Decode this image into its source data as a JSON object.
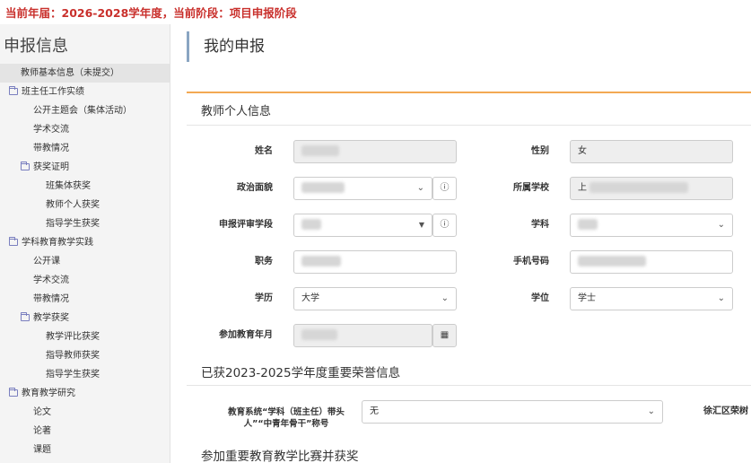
{
  "top_banner": "当前年届：2026-2028学年度，当前阶段：项目申报阶段",
  "sidebar": {
    "title": "申报信息",
    "items": [
      {
        "label": "教师基本信息（未提交）",
        "level": "l1-leaf",
        "folder": false,
        "active": true
      },
      {
        "label": "班主任工作实绩",
        "level": "l1",
        "folder": true
      },
      {
        "label": "公开主题会（集体活动）",
        "level": "l2-leaf",
        "folder": false
      },
      {
        "label": "学术交流",
        "level": "l2-leaf",
        "folder": false
      },
      {
        "label": "带教情况",
        "level": "l2-leaf",
        "folder": false
      },
      {
        "label": "获奖证明",
        "level": "l2",
        "folder": true
      },
      {
        "label": "班集体获奖",
        "level": "l3-leaf",
        "folder": false
      },
      {
        "label": "教师个人获奖",
        "level": "l3-leaf",
        "folder": false
      },
      {
        "label": "指导学生获奖",
        "level": "l3-leaf",
        "folder": false
      },
      {
        "label": "学科教育教学实践",
        "level": "l1",
        "folder": true
      },
      {
        "label": "公开课",
        "level": "l2-leaf",
        "folder": false
      },
      {
        "label": "学术交流",
        "level": "l2-leaf",
        "folder": false
      },
      {
        "label": "带教情况",
        "level": "l2-leaf",
        "folder": false
      },
      {
        "label": "教学获奖",
        "level": "l2",
        "folder": true
      },
      {
        "label": "教学评比获奖",
        "level": "l3-leaf",
        "folder": false
      },
      {
        "label": "指导教师获奖",
        "level": "l3-leaf",
        "folder": false
      },
      {
        "label": "指导学生获奖",
        "level": "l3-leaf",
        "folder": false
      },
      {
        "label": "教育教学研究",
        "level": "l1",
        "folder": true
      },
      {
        "label": "论文",
        "level": "l2-leaf",
        "folder": false
      },
      {
        "label": "论著",
        "level": "l2-leaf",
        "folder": false
      },
      {
        "label": "课题",
        "level": "l2-leaf",
        "folder": false
      }
    ]
  },
  "page": {
    "title": "我的申报",
    "card_title": "教师个人信息",
    "section2_title": "已获2023-2025学年度重要荣誉信息",
    "section3_title": "参加重要教育教学比赛并获奖"
  },
  "form": {
    "name_label": "姓名",
    "gender_label": "性别",
    "gender_value": "女",
    "politics_label": "政治面貌",
    "school_label": "所属学校",
    "school_value_prefix": "上",
    "stage_label": "申报评审学段",
    "subject_label": "学科",
    "position_label": "职务",
    "phone_label": "手机号码",
    "education_label": "学历",
    "education_value": "大学",
    "degree_label": "学位",
    "degree_value": "学士",
    "work_year_label": "参加教育年月",
    "honor_label_line1": "教育系统“学科（班主任）带头",
    "honor_label_line2": "人”“中青年骨干”称号",
    "honor_value": "无",
    "honor_right_label": "徐汇区荣树"
  },
  "icons": {
    "help": "question-circle-icon",
    "calendar": "calendar-icon",
    "chevron": "chevron-down-icon",
    "caret": "caret-down-icon",
    "folder": "folder-icon"
  },
  "colors": {
    "banner_red": "#c9302c",
    "accent_orange": "#f3a953",
    "header_bar": "#8aa5c2"
  }
}
